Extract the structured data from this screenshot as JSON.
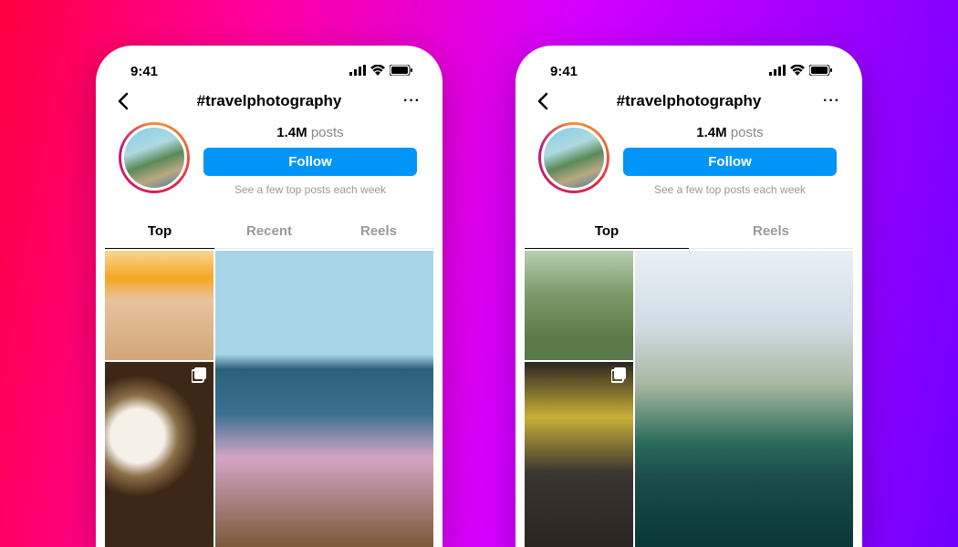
{
  "status": {
    "time": "9:41"
  },
  "header": {
    "hashtag": "#travelphotography",
    "more": "···"
  },
  "stats": {
    "count": "1.4M",
    "posts_label": "posts"
  },
  "follow": {
    "label": "Follow",
    "subtext": "See a few top posts each week"
  },
  "phones": [
    {
      "tabs": [
        {
          "label": "Top",
          "active": true
        },
        {
          "label": "Recent",
          "active": false
        },
        {
          "label": "Reels",
          "active": false
        }
      ]
    },
    {
      "tabs": [
        {
          "label": "Top",
          "active": true
        },
        {
          "label": "Reels",
          "active": false
        }
      ]
    }
  ]
}
